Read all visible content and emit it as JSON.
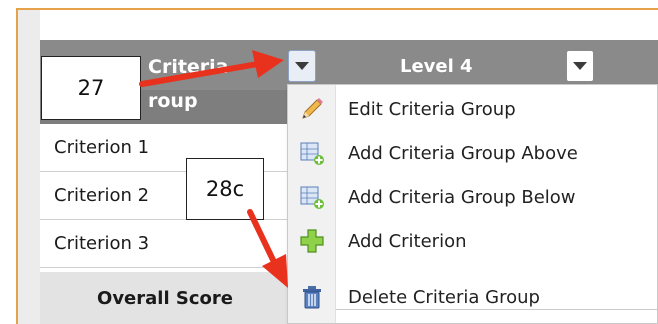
{
  "table": {
    "header_criteria_line1": "Criteria",
    "header_criteria_line2": "roup",
    "header_level": "Level 4",
    "rows": [
      "Criterion 1",
      "Criterion 2",
      "Criterion 3"
    ],
    "overall_score": "Overall Score"
  },
  "menu": {
    "items": [
      {
        "label": "Edit Criteria Group",
        "icon": "pencil-icon"
      },
      {
        "label": "Add Criteria Group Above",
        "icon": "add-group-above-icon"
      },
      {
        "label": "Add Criteria Group Below",
        "icon": "add-group-below-icon"
      },
      {
        "label": "Add Criterion",
        "icon": "plus-icon"
      },
      {
        "label": "Delete Criteria Group",
        "icon": "trash-icon"
      }
    ]
  },
  "callouts": {
    "first": "27",
    "second": "28c"
  },
  "colors": {
    "header_bg": "#8a8a8a",
    "arrow": "#e8321d",
    "frame_accent": "#e6a24a",
    "overall_bg": "#e3e3e3"
  }
}
